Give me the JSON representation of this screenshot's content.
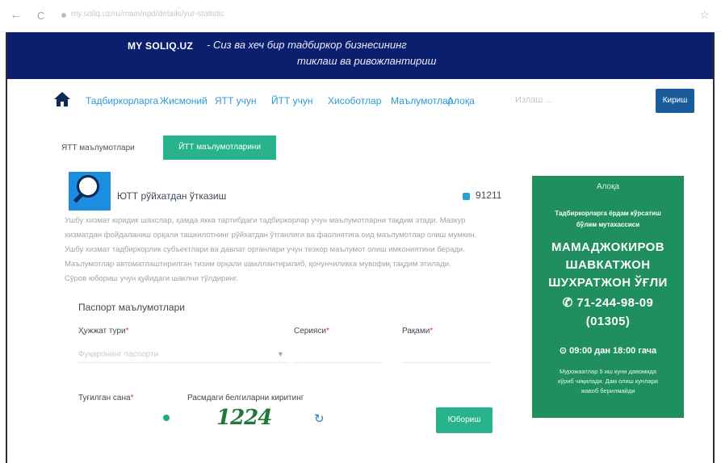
{
  "browser": {
    "back_glyph": "←",
    "reload_glyph": "C",
    "url": "my.soliq.uz/ru/main/npd/details/yur-statistic-form",
    "star_glyph": "☆"
  },
  "brand": {
    "name": "MY SOLIQ.UZ",
    "slogan_line1": "- Сиз ва хеч бир тадбиркор бизнесининг",
    "slogan_line2": "тиклаш ва ривожлантириш"
  },
  "nav": {
    "home_icon": "home-icon",
    "links": [
      "Тадбиркорларга",
      "Жисмоний",
      "ЯТТ учун",
      "ЙТТ учун",
      "Хисоботлар",
      "Маълумотлар",
      "Алоқа"
    ],
    "search_placeholder": "Излаш ...",
    "login_label": "Кириш"
  },
  "tabs": {
    "plain_label": "ЯТТ маълумотлари",
    "active_label": "ЙТТ маълумотларини"
  },
  "service": {
    "logo_icon": "magnifier-logo-icon",
    "title": "ЮТТ рўйхатдан ўтказиш",
    "eye_icon": "eye-icon",
    "views": "91211"
  },
  "description": [
    "Ушбу хизмат юридик шахслар, ҳамда якка тартибдаги тадбиркорлар учун маълумотларни тақдим этади. Мазкур",
    "хизматдан фойдаланиш орқали ташкилотнинг рўйхатдан ўтганлиги ва фаолиятига оид маълумотлар олиш мумкин.",
    "Ушбу хизмат тадбиркорлик субъектлари ва давлат органлари учун тезкор маълумот олиш имкониятини беради.",
    "Маълумотлар автоматлаштирилган тизим орқали шакллантирилиб, қонунчиликка мувофиқ тақдим этилади.",
    "Сўров юбориш учун қуйидаги шаклни тўлдиринг."
  ],
  "form": {
    "title": "Паспорт маълумотлари",
    "doc_type_label": "Ҳужжат тури",
    "doc_type_value": "Фуқаронинг паспорти",
    "series_label": "Серияси",
    "number_label": "Рақами",
    "birth_label": "Туғилган сана",
    "captcha_label": "Расмдаги белгиларни киритинг",
    "captcha_code": "1224",
    "refresh_icon": "refresh-icon",
    "submit_label": "Юбориш",
    "required_mark": "*"
  },
  "aside": {
    "header": "Алоқа",
    "sub1": "Тадбиркорларга ёрдам кўрсатиш",
    "sub2": "бўлим мутахассиси",
    "name1": "МАМАДЖОКИРОВ",
    "name2": "ШАВКАТЖОН",
    "name3": "ШУХРАТЖОН ЎҒЛИ",
    "phone": "✆ 71-244-98-09",
    "ext": "(01305)",
    "hours": "⊙ 09:00 дан 18:00 гача",
    "note1": "Мурожаатлар 5 иш куни давомида",
    "note2": "кўриб чиқилади. Дам олиш кунлари",
    "note3": "жавоб берилмайди"
  }
}
